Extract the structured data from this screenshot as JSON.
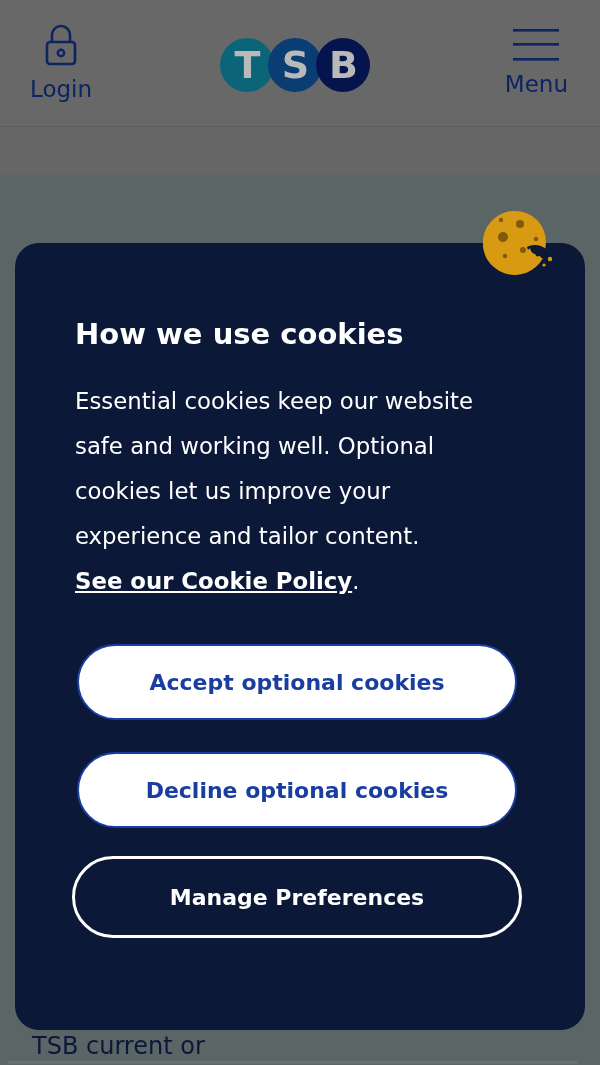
{
  "header": {
    "login": "Login",
    "logo_letters": [
      "T",
      "S",
      "B"
    ],
    "menu": "Menu"
  },
  "page": {
    "visible_text": "TSB current or"
  },
  "cookie_dialog": {
    "title": "How we use cookies",
    "text": "Essential cookies keep our website safe and working well. Optional cookies let us improve your experience and tailor content. ",
    "link": "See our Cookie Policy",
    "text_end": ".",
    "buttons": [
      {
        "label": "Accept optional cookies",
        "kind": "filled"
      },
      {
        "label": "Decline optional cookies",
        "kind": "filled"
      },
      {
        "label": "Manage Preferences",
        "kind": "outline"
      }
    ]
  }
}
